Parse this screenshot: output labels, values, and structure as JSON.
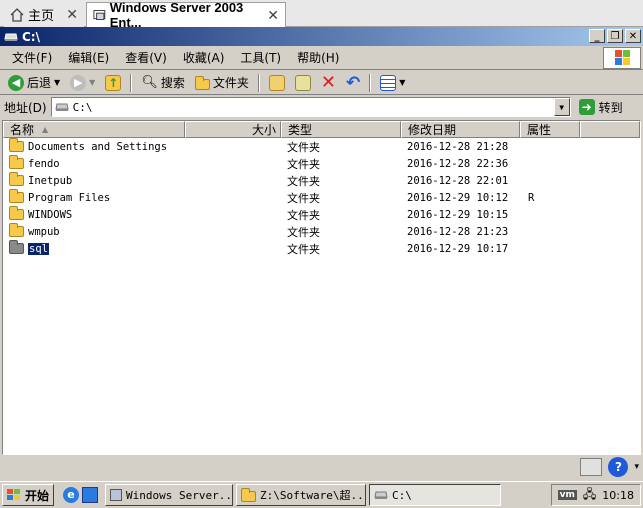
{
  "host_tabs": {
    "home_label": "主页",
    "active_label": "Windows Server 2003 Ent..."
  },
  "window": {
    "title": "C:\\"
  },
  "menu": [
    "文件(F)",
    "编辑(E)",
    "查看(V)",
    "收藏(A)",
    "工具(T)",
    "帮助(H)"
  ],
  "toolbar": {
    "back": "后退",
    "search": "搜索",
    "folders": "文件夹"
  },
  "address": {
    "label": "地址(D)",
    "value": "C:\\",
    "go": "转到"
  },
  "columns": {
    "name": "名称",
    "size": "大小",
    "type": "类型",
    "date": "修改日期",
    "attr": "属性"
  },
  "files": [
    {
      "name": "Documents and Settings",
      "type": "文件夹",
      "date": "2016-12-28 21:28",
      "attr": ""
    },
    {
      "name": "fendo",
      "type": "文件夹",
      "date": "2016-12-28 22:36",
      "attr": ""
    },
    {
      "name": "Inetpub",
      "type": "文件夹",
      "date": "2016-12-28 22:01",
      "attr": ""
    },
    {
      "name": "Program Files",
      "type": "文件夹",
      "date": "2016-12-29 10:12",
      "attr": "R"
    },
    {
      "name": "WINDOWS",
      "type": "文件夹",
      "date": "2016-12-29 10:15",
      "attr": ""
    },
    {
      "name": "wmpub",
      "type": "文件夹",
      "date": "2016-12-28 21:23",
      "attr": ""
    },
    {
      "name": "sql",
      "type": "文件夹",
      "date": "2016-12-29 10:17",
      "attr": ""
    }
  ],
  "selected_index": 6,
  "taskbar": {
    "start": "开始",
    "items": [
      "Windows Server...",
      "Z:\\Software\\超...",
      "C:\\"
    ],
    "clock": "10:18"
  },
  "colors": {
    "title_start": "#0a246a",
    "title_end": "#a6caf0",
    "selection": "#0a246a",
    "face": "#d4d0c8"
  }
}
